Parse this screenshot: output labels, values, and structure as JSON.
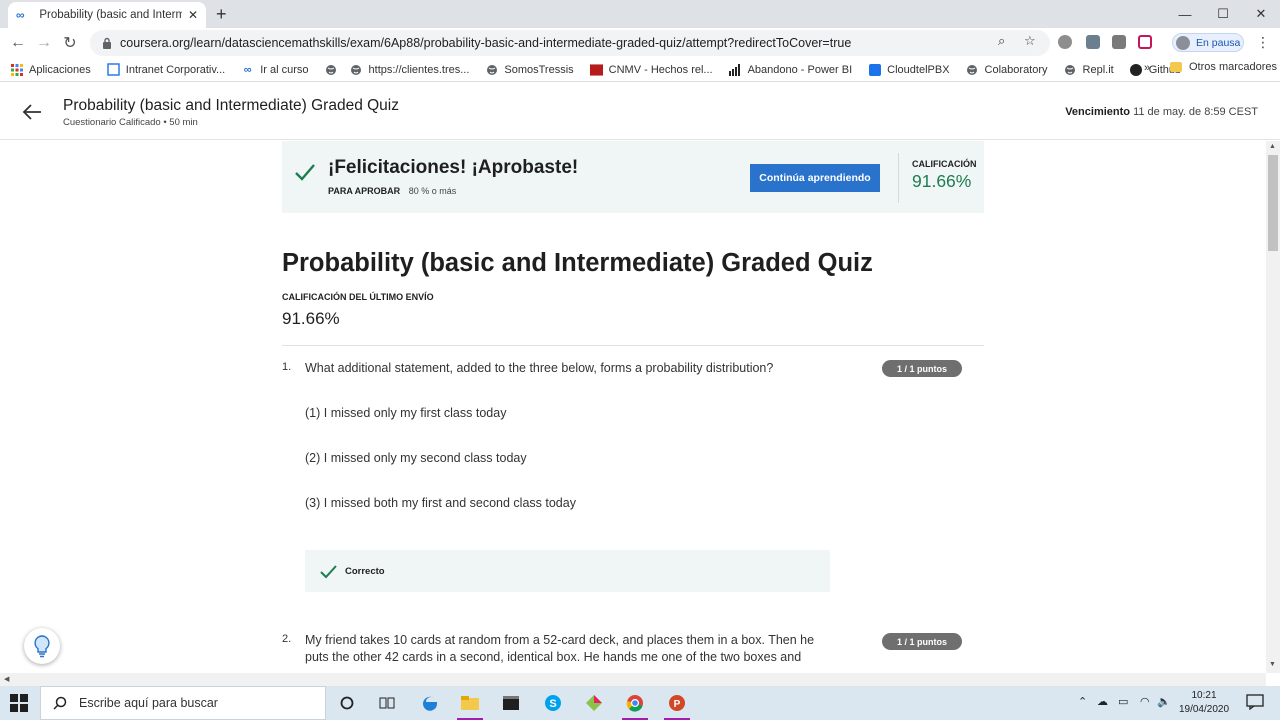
{
  "browser": {
    "tab_title": "Probability (basic and Intermediate",
    "url": "coursera.org/learn/datasciencemathskills/exam/6Ap88/probability-basic-and-intermediate-graded-quiz/attempt?redirectToCover=true",
    "profile_label": "En pausa",
    "bookmarks": [
      {
        "label": "Aplicaciones",
        "icon": "apps-grid-icon"
      },
      {
        "label": "Intranet Corporativ...",
        "icon": "intranet-icon"
      },
      {
        "label": "Ir al curso",
        "icon": "coursera-icon"
      },
      {
        "label": "",
        "icon": "globe-icon"
      },
      {
        "label": "https://clientes.tres...",
        "icon": "globe-icon"
      },
      {
        "label": "SomosTressis",
        "icon": "globe-icon"
      },
      {
        "label": "CNMV - Hechos rel...",
        "icon": "cnmv-icon"
      },
      {
        "label": "Abandono - Power BI",
        "icon": "power-bi-icon"
      },
      {
        "label": "CloudtelPBX",
        "icon": "cloudtel-icon"
      },
      {
        "label": "Colaboratory",
        "icon": "globe-icon"
      },
      {
        "label": "Repl.it",
        "icon": "globe-icon"
      },
      {
        "label": "Github",
        "icon": "github-icon"
      }
    ],
    "bookmarks_more": "»",
    "other_bookmarks": "Otros marcadores"
  },
  "header": {
    "title": "Probability (basic and Intermediate) Graded Quiz",
    "subtitle": "Cuestionario Calificado • 50 min",
    "due_label": "Vencimiento",
    "due_value": "11 de may. de 8:59 CEST"
  },
  "banner": {
    "congrats": "¡Felicitaciones! ¡Aprobaste!",
    "pass_label": "PARA APROBAR",
    "pass_value": "80 % o más",
    "continue_button": "Continúa aprendiendo",
    "grade_label": "CALIFICACIÓN",
    "grade_value": "91.66%",
    "accent_color": "#1d7c50",
    "button_color": "#2a73cc"
  },
  "quiz": {
    "title": "Probability (basic and Intermediate) Graded Quiz",
    "last_grade_label": "CALIFICACIÓN DEL ÚLTIMO ENVÍO",
    "last_grade_value": "91.66%",
    "questions": [
      {
        "number": "1.",
        "text": "What additional statement, added to the three below, forms a probability distribution?",
        "points": "1 / 1 puntos",
        "options": [
          "(1) I missed only my first class today",
          "(2) I missed only my second class today",
          "(3) I missed both my first and second class today"
        ],
        "feedback": "Correcto"
      },
      {
        "number": "2.",
        "text_lines": [
          "My friend takes 10 cards at random from a 52-card deck, and places them in a box. Then he",
          "puts the other 42 cards in a second, identical box. He hands me one of the two boxes and"
        ],
        "points": "1 / 1 puntos"
      }
    ]
  },
  "taskbar": {
    "search_placeholder": "Escribe aquí para buscar",
    "time": "10:21",
    "date": "19/04/2020"
  }
}
